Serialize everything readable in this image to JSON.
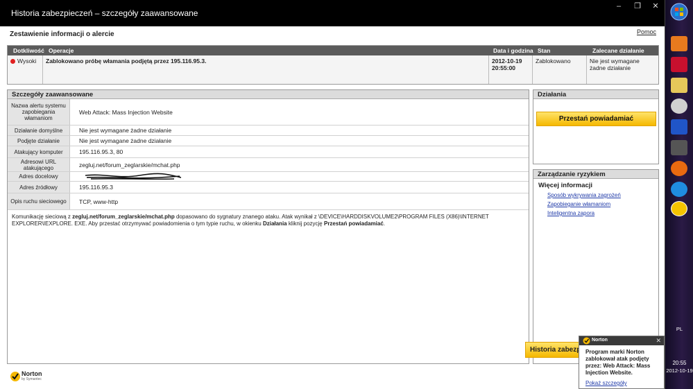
{
  "window": {
    "title": "Historia zabezpieczeń – szczegóły zaawansowane",
    "help_label": "Pomoc"
  },
  "summary": {
    "heading": "Zestawienie informacji o alercie",
    "columns": [
      "Dotkliwość",
      "Operacje",
      "Data i godzina",
      "Stan",
      "Zalecane działanie"
    ],
    "row": {
      "severity": "Wysoki",
      "operation": "Zablokowano próbę włamania podjętą przez 195.116.95.3.",
      "date": "2012-10-19",
      "time": "20:55:00",
      "status": "Zablokowano",
      "recommended": "Nie jest wymagane żadne działanie"
    }
  },
  "details": {
    "heading": "Szczegóły zaawansowane",
    "rows": [
      {
        "label": "Nazwa alertu systemu zapobiegania włamaniom",
        "value": "Web Attack: Mass Injection Website"
      },
      {
        "label": "Działanie domyślne",
        "value": "Nie jest wymagane żadne działanie"
      },
      {
        "label": "Podjęte działanie",
        "value": "Nie jest wymagane żadne działanie"
      },
      {
        "label": "Atakujący komputer",
        "value": "195.116.95.3, 80"
      },
      {
        "label": "Adresowi URL atakującego",
        "value": "zegluj.net/forum_zeglarskie/mchat.php"
      },
      {
        "label": "Adres docelowy",
        "value": ""
      },
      {
        "label": "Adres źródłowy",
        "value": "195.116.95.3"
      },
      {
        "label": "Opis ruchu sieciowego",
        "value": "TCP, www-http"
      }
    ],
    "description": {
      "p1": "Komunikację sieciową z ",
      "url": "zegluj.net/forum_zeglarskie/mchat.php",
      "p2": " dopasowano do sygnatury znanego ataku. Atak wynikał z \\DEVICE\\HARDDISKVOLUME2\\PROGRAM FILES (X86)\\INTERNET EXPLORER\\IEXPLORE. EXE. Aby przestać otrzymywać powiadomienia o tym typie ruchu, w okienku ",
      "b1": "Działania",
      "p3": " kliknij pozycję ",
      "b2": "Przestań powiadamiać",
      "p4": "."
    }
  },
  "actions": {
    "heading": "Działania",
    "stop_label": "Przestań powiadamiać"
  },
  "risk": {
    "heading": "Zarządzanie ryzykiem",
    "subheading": "Więcej informacji",
    "links": [
      "Sposób wykrywania zagrożeń",
      "Zapobieganie włamaniom",
      "Inteligentna zapora"
    ]
  },
  "footer": {
    "logo_text": "Norton",
    "logo_sub": "by Symantec",
    "history_label": "Historia zabezpieczeń"
  },
  "popup": {
    "brand": "Norton",
    "message": "Program marki Norton zablokował atak podjęty przez: Web Attack: Mass Injection Website.",
    "link": "Pokaż szczegóły"
  },
  "taskbar": {
    "lang": "PL",
    "time": "20:55",
    "date": "2012-10-19"
  }
}
